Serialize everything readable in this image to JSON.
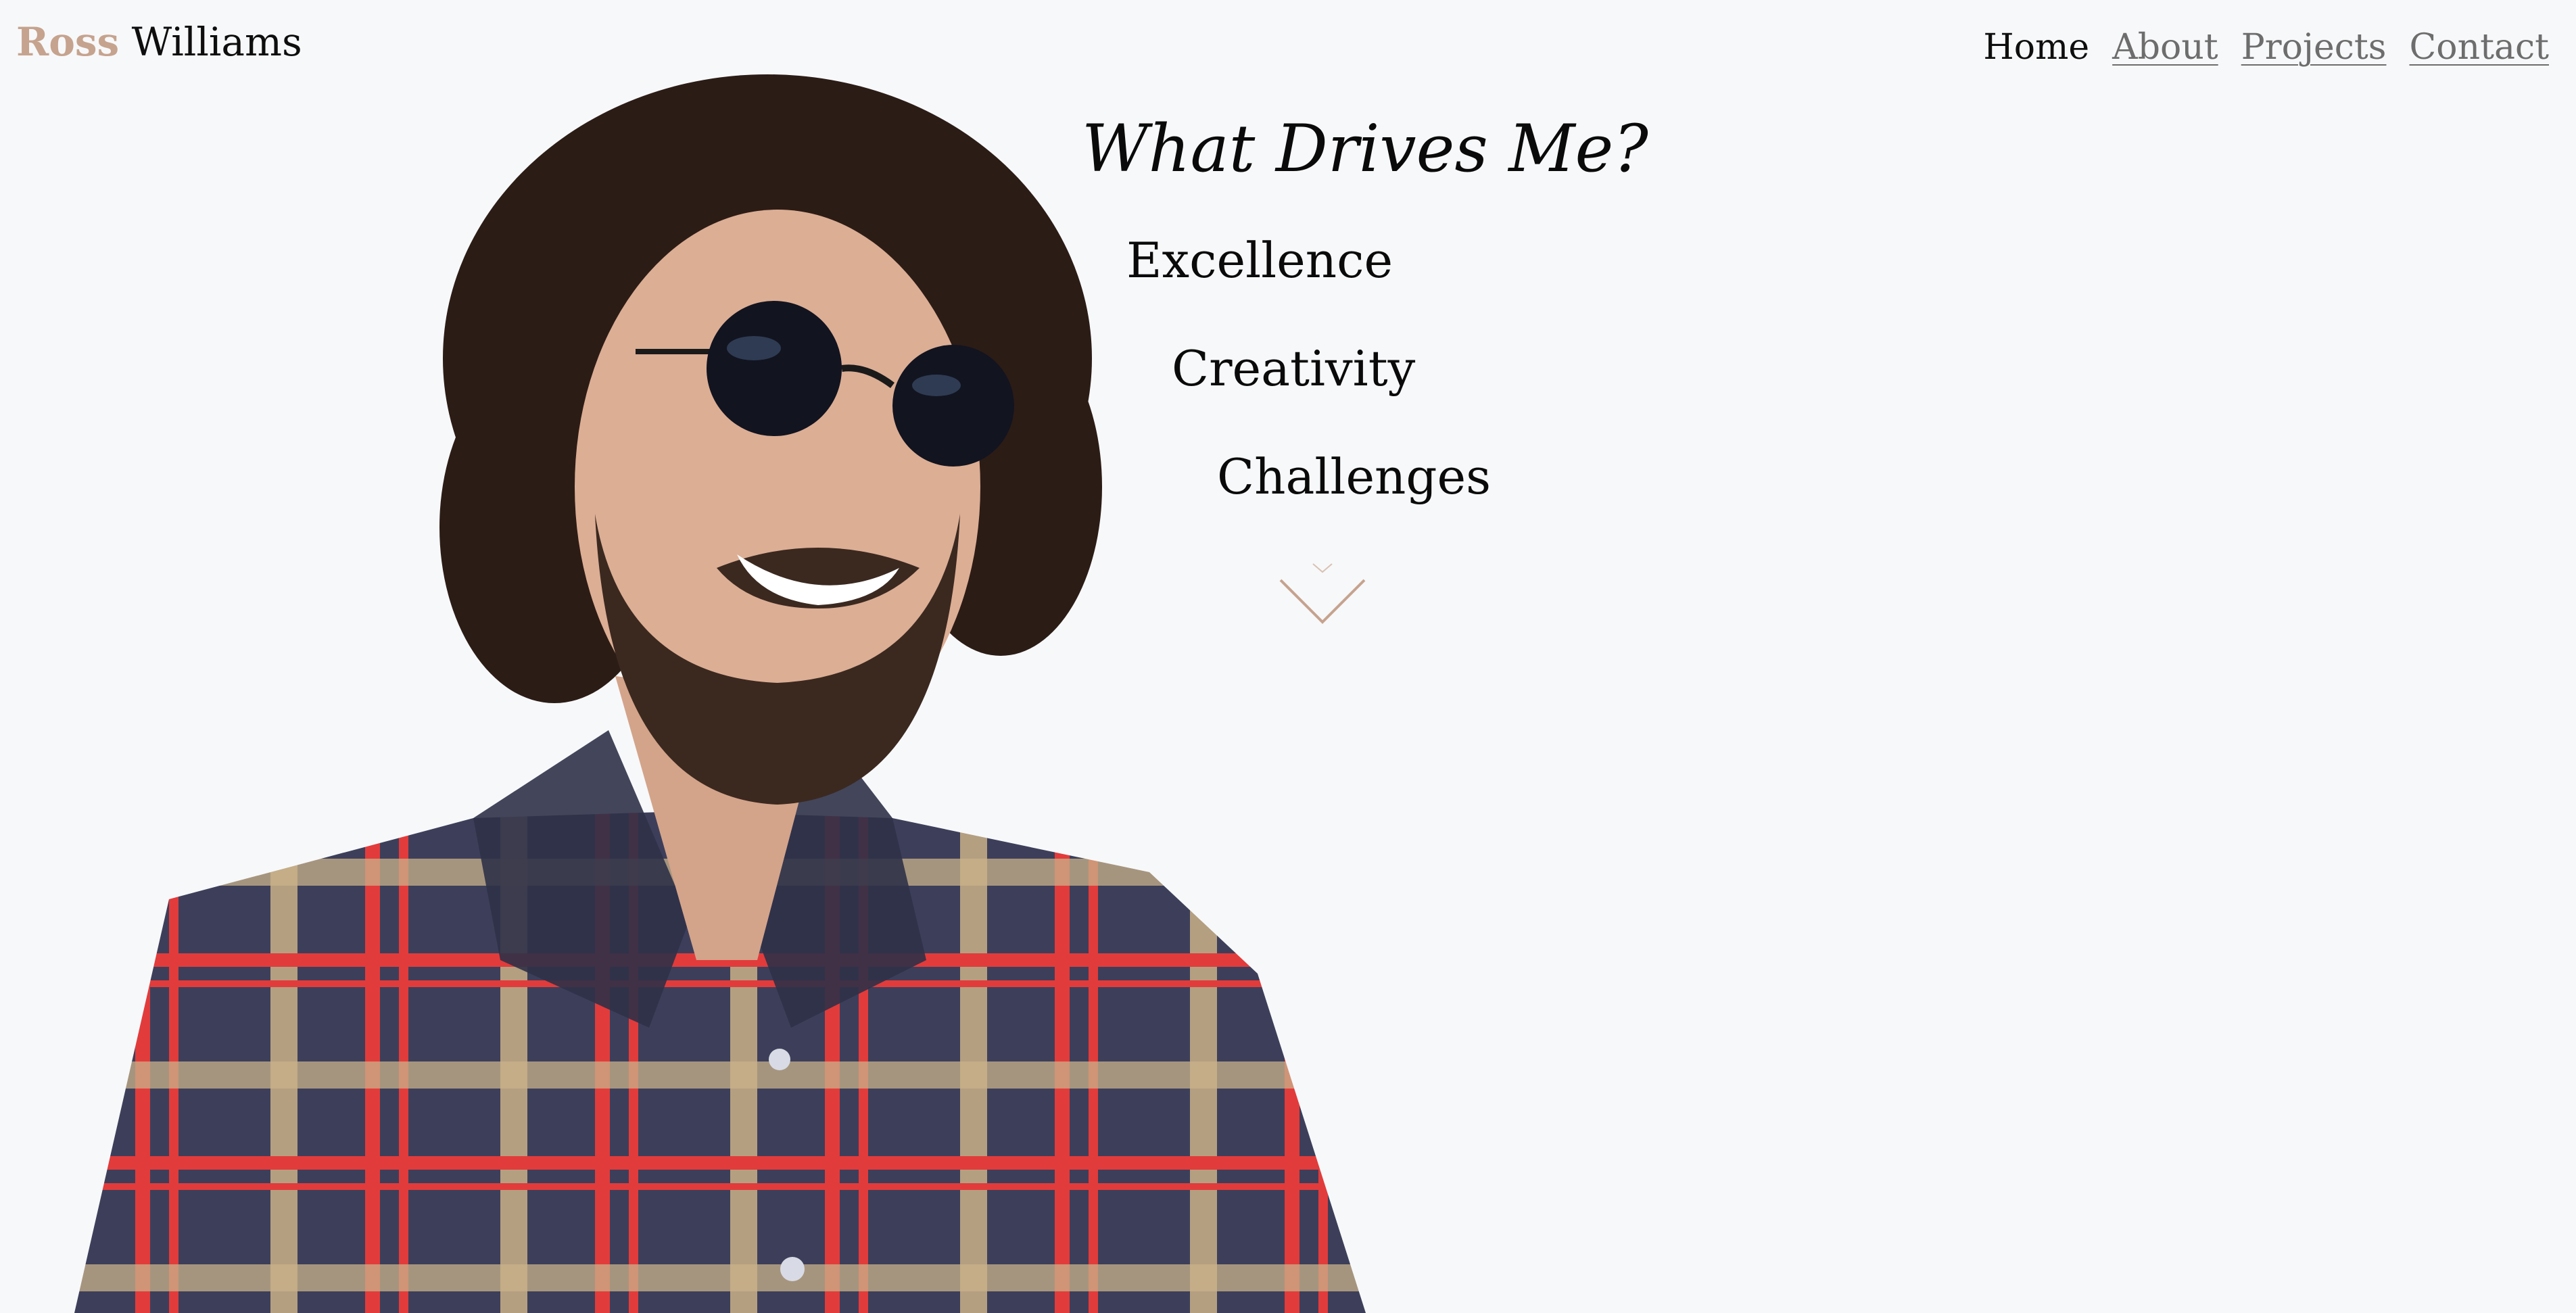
{
  "header": {
    "brand_first": "Ross",
    "brand_last": "Williams"
  },
  "nav": {
    "items": [
      {
        "label": "Home",
        "active": true
      },
      {
        "label": "About",
        "active": false
      },
      {
        "label": "Projects",
        "active": false
      },
      {
        "label": "Contact",
        "active": false
      }
    ]
  },
  "hero": {
    "title": "What Drives Me?",
    "values": [
      "Excellence",
      "Creativity",
      "Challenges"
    ],
    "scroll_icon": "chevron-down-icon"
  },
  "colors": {
    "background": "#f7f8fa",
    "brand_accent": "#c6a38e",
    "text": "#0e0e0e",
    "nav_link": "#6d6d6d"
  }
}
